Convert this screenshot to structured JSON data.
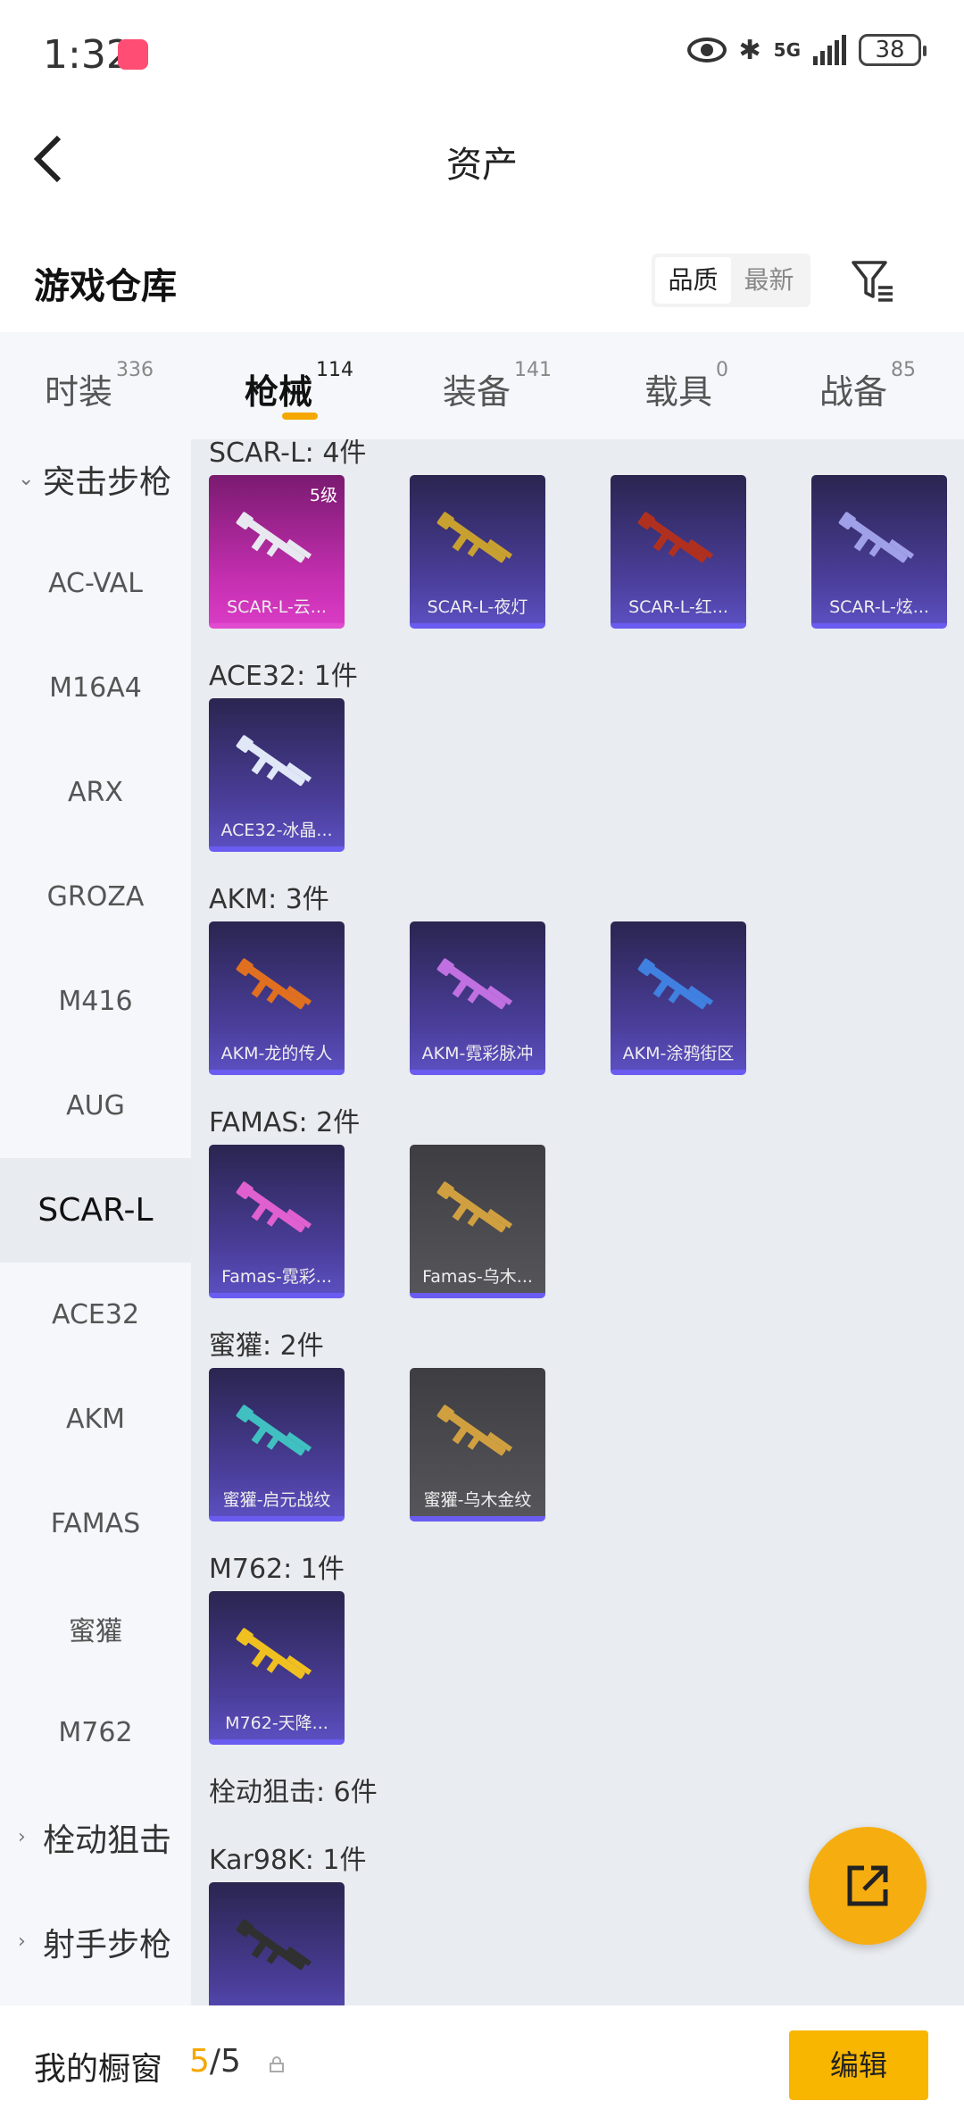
{
  "status": {
    "time": "1:32",
    "network": "5G",
    "battery": "38"
  },
  "nav": {
    "title": "资产"
  },
  "section": {
    "title": "游戏仓库",
    "sort_options": [
      "品质",
      "最新"
    ]
  },
  "tabs": [
    {
      "label": "时装",
      "count": "336"
    },
    {
      "label": "枪械",
      "count": "114"
    },
    {
      "label": "装备",
      "count": "141"
    },
    {
      "label": "载具",
      "count": "0"
    },
    {
      "label": "战备",
      "count": "85"
    }
  ],
  "sidebar": [
    {
      "label": "突击步枪",
      "type": "group-open"
    },
    {
      "label": "AC-VAL"
    },
    {
      "label": "M16A4"
    },
    {
      "label": "ARX"
    },
    {
      "label": "GROZA"
    },
    {
      "label": "M416"
    },
    {
      "label": "AUG"
    },
    {
      "label": "SCAR-L",
      "selected": true
    },
    {
      "label": "ACE32"
    },
    {
      "label": "AKM"
    },
    {
      "label": "FAMAS"
    },
    {
      "label": "蜜獾"
    },
    {
      "label": "M762"
    },
    {
      "label": "栓动狙击",
      "type": "group-closed"
    },
    {
      "label": "射手步枪",
      "type": "group-closed"
    }
  ],
  "groups": [
    {
      "label": "SCAR-L: 4件",
      "items": [
        {
          "name": "SCAR-L-云...",
          "style": "pink",
          "level": "5级",
          "color": "#e8e8f0"
        },
        {
          "name": "SCAR-L-夜灯",
          "style": "purple",
          "color": "#c8a030"
        },
        {
          "name": "SCAR-L-红...",
          "style": "purple",
          "color": "#b03020"
        },
        {
          "name": "SCAR-L-炫...",
          "style": "purple",
          "color": "#a0a0e8"
        }
      ]
    },
    {
      "label": "ACE32: 1件",
      "items": [
        {
          "name": "ACE32-冰晶...",
          "style": "purple",
          "color": "#e0e8f8"
        }
      ]
    },
    {
      "label": "AKM: 3件",
      "items": [
        {
          "name": "AKM-龙的传人",
          "style": "purple",
          "color": "#e07020"
        },
        {
          "name": "AKM-霓彩脉冲",
          "style": "purple",
          "color": "#c070e0"
        },
        {
          "name": "AKM-涂鸦街区",
          "style": "purple",
          "color": "#4080e0"
        }
      ]
    },
    {
      "label": "FAMAS: 2件",
      "items": [
        {
          "name": "Famas-霓彩...",
          "style": "purple",
          "color": "#e060d0"
        },
        {
          "name": "Famas-乌木...",
          "style": "gray",
          "color": "#d0a040"
        }
      ]
    },
    {
      "label": "蜜獾: 2件",
      "items": [
        {
          "name": "蜜獾-启元战纹",
          "style": "purple",
          "color": "#40c0c0"
        },
        {
          "name": "蜜獾-乌木金纹",
          "style": "gray",
          "color": "#d0a040"
        }
      ]
    },
    {
      "label": "M762: 1件",
      "items": [
        {
          "name": "M762-天降...",
          "style": "purple",
          "color": "#f0c020"
        }
      ]
    },
    {
      "label": "栓动狙击: 6件",
      "items": []
    },
    {
      "label": "Kar98K: 1件",
      "items": [
        {
          "name": "",
          "style": "purple",
          "color": "#303030"
        }
      ]
    }
  ],
  "bottom": {
    "label": "我的橱窗",
    "current": "5",
    "total": "/5",
    "edit_label": "编辑"
  },
  "colors": {
    "accent": "#f5a800"
  }
}
